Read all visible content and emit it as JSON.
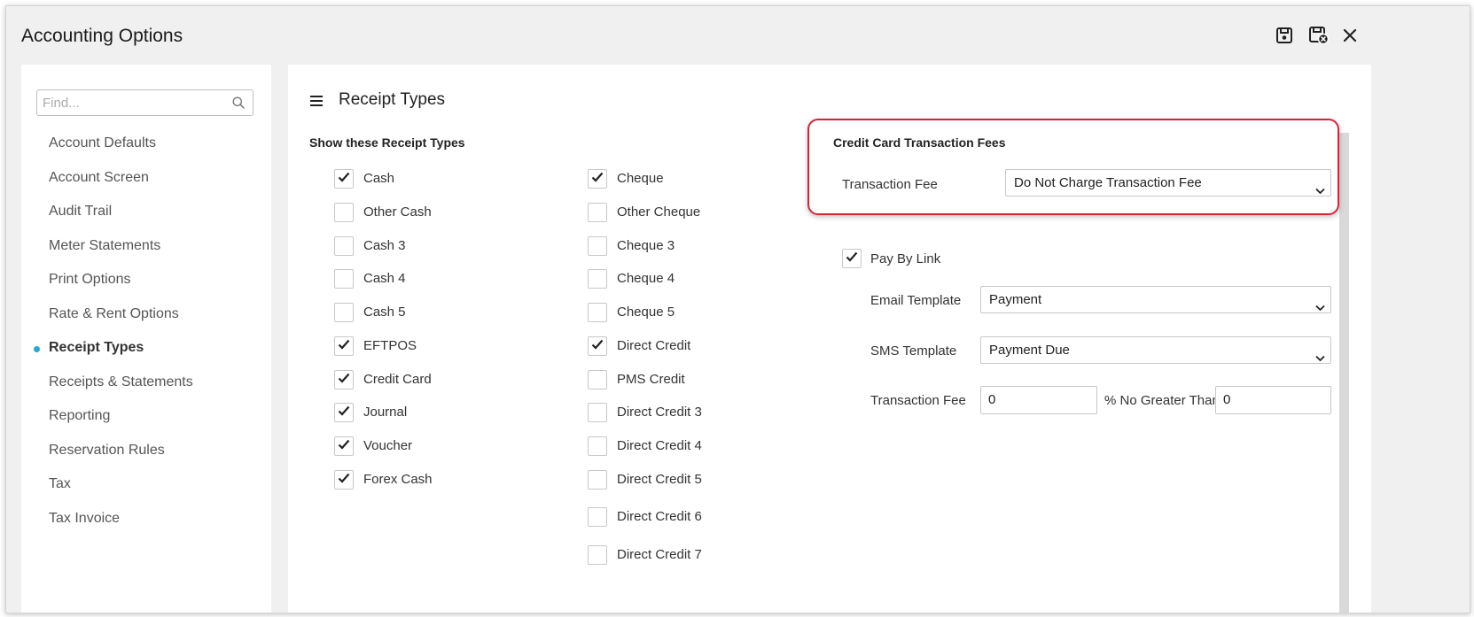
{
  "window": {
    "title": "Accounting Options",
    "toolbar": {
      "save": "save-icon",
      "save_close": "save-close-icon",
      "close": "close-icon"
    }
  },
  "sidebar": {
    "search_placeholder": "Find...",
    "items": [
      {
        "label": "Account Defaults",
        "active": false
      },
      {
        "label": "Account Screen",
        "active": false
      },
      {
        "label": "Audit Trail",
        "active": false
      },
      {
        "label": "Meter Statements",
        "active": false
      },
      {
        "label": "Print Options",
        "active": false
      },
      {
        "label": "Rate & Rent Options",
        "active": false
      },
      {
        "label": "Receipt Types",
        "active": true
      },
      {
        "label": "Receipts & Statements",
        "active": false
      },
      {
        "label": "Reporting",
        "active": false
      },
      {
        "label": "Reservation Rules",
        "active": false
      },
      {
        "label": "Tax",
        "active": false
      },
      {
        "label": "Tax Invoice",
        "active": false
      }
    ]
  },
  "main": {
    "title": "Receipt Types",
    "show_heading": "Show these Receipt Types",
    "col1": [
      {
        "label": "Cash",
        "checked": true
      },
      {
        "label": "Other Cash",
        "checked": false
      },
      {
        "label": "Cash 3",
        "checked": false
      },
      {
        "label": "Cash 4",
        "checked": false
      },
      {
        "label": "Cash 5",
        "checked": false
      },
      {
        "label": "EFTPOS",
        "checked": true
      },
      {
        "label": "Credit Card",
        "checked": true
      },
      {
        "label": "Journal",
        "checked": true
      },
      {
        "label": "Voucher",
        "checked": true
      },
      {
        "label": "Forex Cash",
        "checked": true
      }
    ],
    "col2": [
      {
        "label": "Cheque",
        "checked": true
      },
      {
        "label": "Other Cheque",
        "checked": false
      },
      {
        "label": "Cheque 3",
        "checked": false
      },
      {
        "label": "Cheque 4",
        "checked": false
      },
      {
        "label": "Cheque 5",
        "checked": false
      },
      {
        "label": "Direct Credit",
        "checked": true
      },
      {
        "label": "PMS Credit",
        "checked": false
      },
      {
        "label": "Direct Credit 3",
        "checked": false
      },
      {
        "label": "Direct Credit 4",
        "checked": false
      },
      {
        "label": "Direct Credit 5",
        "checked": false
      },
      {
        "label": "Direct Credit 6",
        "checked": false
      },
      {
        "label": "Direct Credit 7",
        "checked": false
      }
    ],
    "cc_fees": {
      "heading": "Credit Card Transaction Fees",
      "fee_label": "Transaction Fee",
      "fee_value": "Do Not Charge Transaction Fee",
      "highlight_color": "#d0283a"
    },
    "pay_by_link": {
      "label": "Pay By Link",
      "checked": true,
      "email_label": "Email Template",
      "email_value": "Payment",
      "sms_label": "SMS Template",
      "sms_value": "Payment Due",
      "fee_label": "Transaction Fee",
      "fee_value": "0",
      "max_label": "% No Greater Than",
      "max_value": "0"
    }
  },
  "colors": {
    "accent": "#2aa8c9",
    "window_bg": "#f0f0f0",
    "panel_bg": "#ffffff"
  }
}
